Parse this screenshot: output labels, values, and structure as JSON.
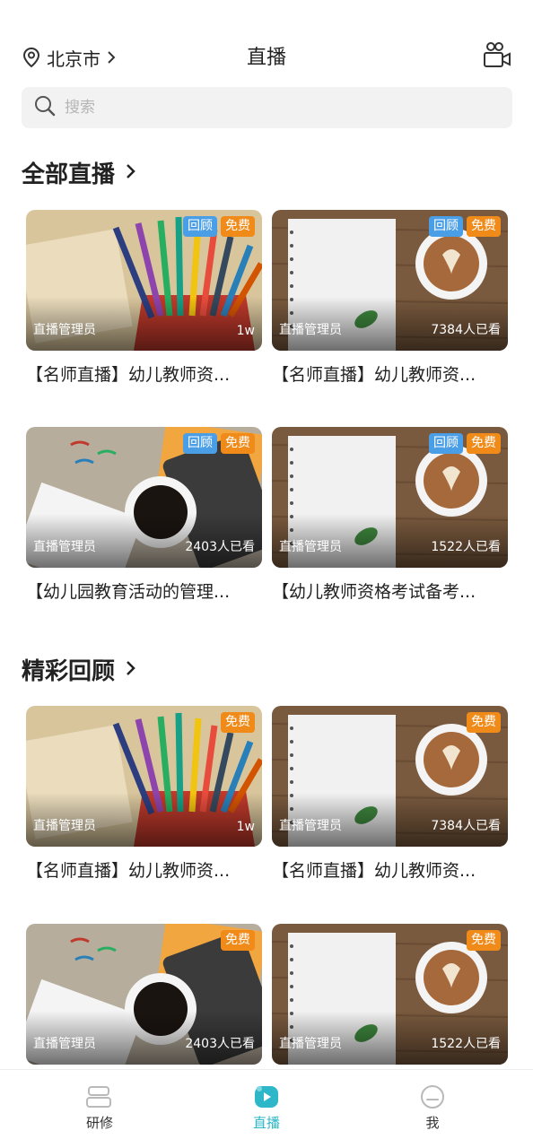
{
  "header": {
    "location": "北京市",
    "title": "直播",
    "camera_icon": "video-camera-icon"
  },
  "search": {
    "placeholder": "搜索"
  },
  "sections": [
    {
      "title": "全部直播",
      "cards": [
        {
          "image": "pencils",
          "badges": [
            "回顾",
            "免费"
          ],
          "author": "直播管理员",
          "views": "1w",
          "title": "【名师直播】幼儿教师资..."
        },
        {
          "image": "notebook",
          "badges": [
            "回顾",
            "免费"
          ],
          "author": "直播管理员",
          "views": "7384人已看",
          "title": "【名师直播】幼儿教师资..."
        },
        {
          "image": "coffee",
          "badges": [
            "回顾",
            "免费"
          ],
          "author": "直播管理员",
          "views": "2403人已看",
          "title": "【幼儿园教育活动的管理..."
        },
        {
          "image": "notebook",
          "badges": [
            "回顾",
            "免费"
          ],
          "author": "直播管理员",
          "views": "1522人已看",
          "title": "【幼儿教师资格考试备考..."
        }
      ]
    },
    {
      "title": "精彩回顾",
      "cards": [
        {
          "image": "pencils",
          "badges": [
            "免费"
          ],
          "author": "直播管理员",
          "views": "1w",
          "title": "【名师直播】幼儿教师资..."
        },
        {
          "image": "notebook",
          "badges": [
            "免费"
          ],
          "author": "直播管理员",
          "views": "7384人已看",
          "title": "【名师直播】幼儿教师资..."
        },
        {
          "image": "coffee",
          "badges": [
            "免费"
          ],
          "author": "直播管理员",
          "views": "2403人已看",
          "title": ""
        },
        {
          "image": "notebook",
          "badges": [
            "免费"
          ],
          "author": "直播管理员",
          "views": "1522人已看",
          "title": ""
        }
      ]
    }
  ],
  "tabs": [
    {
      "label": "研修",
      "icon": "books-icon",
      "active": false
    },
    {
      "label": "直播",
      "icon": "live-play-icon",
      "active": true
    },
    {
      "label": "我",
      "icon": "profile-face-icon",
      "active": false
    }
  ],
  "colors": {
    "accent": "#2db7c8",
    "badge_review": "#4a9ee6",
    "badge_free": "#f08a18",
    "search_bg": "#f2f2f2"
  }
}
